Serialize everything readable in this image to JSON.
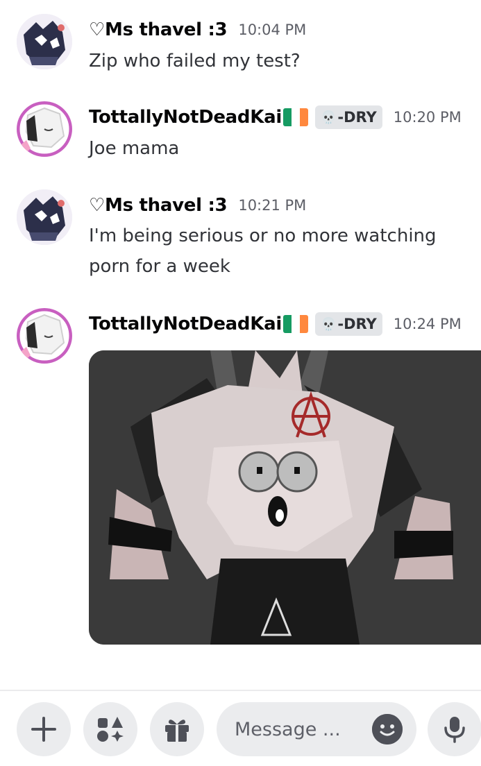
{
  "messages": [
    {
      "username": "♡Ms thavel :3",
      "time": "10:04 PM",
      "text": "Zip who failed my test?"
    },
    {
      "username": "TottallyNotDeadKai",
      "flag": "ireland-flag",
      "tag": "-DRY",
      "tag_icon": "skull-icon",
      "time": "10:20 PM",
      "text": "Joe mama"
    },
    {
      "username": "♡Ms thavel :3",
      "time": "10:21 PM",
      "text": "I'm being serious or no more watching porn for a week"
    },
    {
      "username": "TottallyNotDeadKai",
      "flag": "ireland-flag",
      "tag": "-DRY",
      "tag_icon": "skull-icon",
      "time": "10:24 PM",
      "attachment": "image-attachment"
    }
  ],
  "composer": {
    "placeholder": "Message ...",
    "buttons": [
      "plus-icon",
      "apps-icon",
      "gift-icon",
      "emoji-icon",
      "microphone-icon"
    ]
  },
  "colors": {
    "flag_green": "#169b62",
    "flag_white": "#ffffff",
    "flag_orange": "#ff883e"
  }
}
